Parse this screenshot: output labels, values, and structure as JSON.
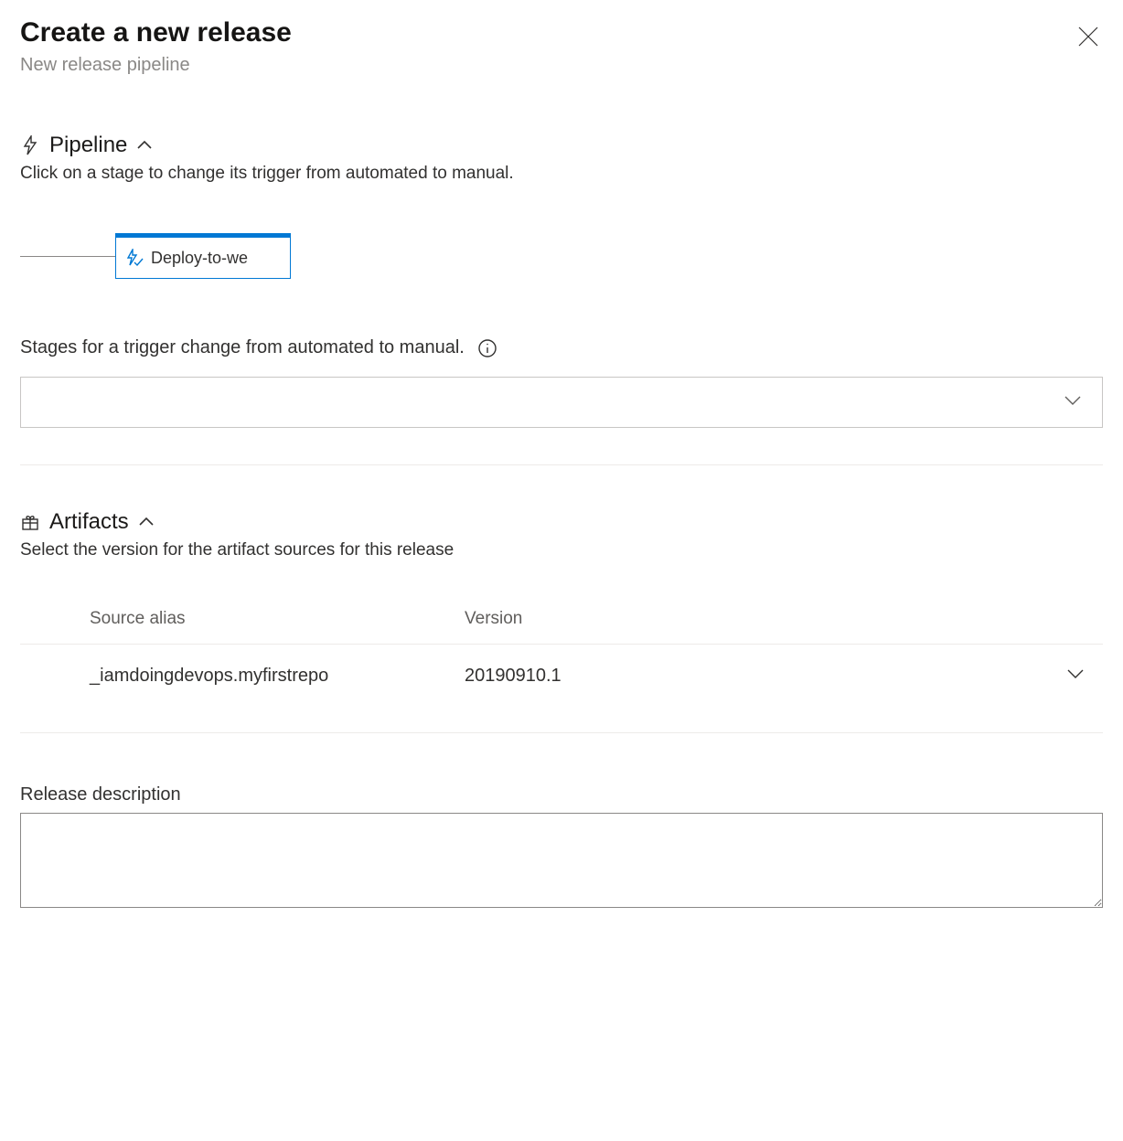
{
  "header": {
    "title": "Create a new release",
    "subtitle": "New release pipeline"
  },
  "pipeline": {
    "section_title": "Pipeline",
    "description": "Click on a stage to change its trigger from automated to manual.",
    "stage_label": "Deploy-to-we",
    "stages_field_label": "Stages for a trigger change from automated to manual.",
    "stages_value": ""
  },
  "artifacts": {
    "section_title": "Artifacts",
    "description": "Select the version for the artifact sources for this release",
    "columns": {
      "source": "Source alias",
      "version": "Version"
    },
    "rows": [
      {
        "source": "_iamdoingdevops.myfirstrepo",
        "version": "20190910.1"
      }
    ]
  },
  "release_description": {
    "label": "Release description",
    "value": ""
  }
}
